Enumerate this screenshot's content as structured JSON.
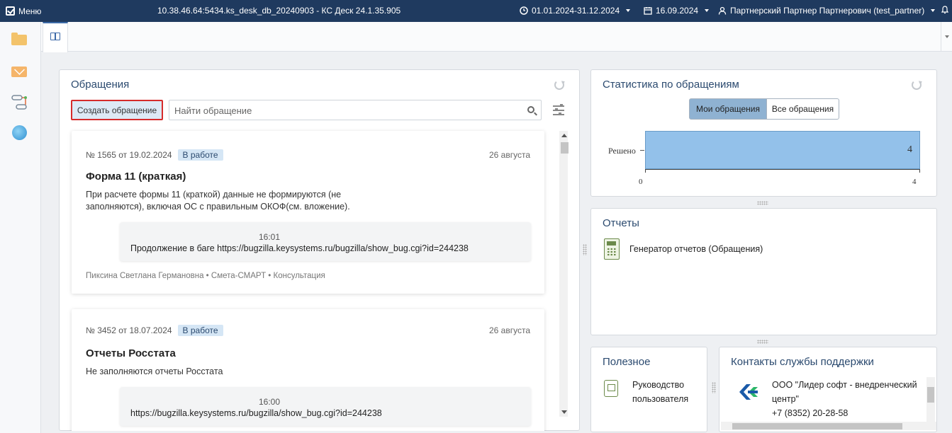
{
  "topbar": {
    "menu_label": "Меню",
    "title": "10.38.46.64:5434.ks_desk_db_20240903 - КС Деск 24.1.35.905",
    "period": "01.01.2024-31.12.2024",
    "date": "16.09.2024",
    "user": "Партнерский Партнер Партнерович (test_partner)"
  },
  "rail": {
    "items": [
      "folder-icon",
      "mail-icon",
      "flow-icon",
      "globe-icon"
    ]
  },
  "appeals": {
    "title": "Обращения",
    "create_label": "Создать обращение",
    "search_placeholder": "Найти обращение",
    "cards": [
      {
        "number": "№ 1565 от 19.02.2024",
        "status": "В работе",
        "date": "26 августа",
        "heading": "Форма 11 (краткая)",
        "desc": "При расчете формы 11 (краткой) данные не формируются (не заполняются), включая ОС с правильным ОКОФ(см. вложение).",
        "time": "16:01",
        "message": "Продолжение в баге https://bugzilla.keysystems.ru/bugzilla/show_bug.cgi?id=244238",
        "footer": "Пиксина Светлана Германовна • Смета-СМАРТ • Консультация"
      },
      {
        "number": "№ 3452 от 18.07.2024",
        "status": "В работе",
        "date": "26 августа",
        "heading": "Отчеты Росстата",
        "desc": "Не заполняются отчеты Росстата",
        "time": "16:00",
        "message": "https://bugzilla.keysystems.ru/bugzilla/show_bug.cgi?id=244238"
      }
    ]
  },
  "stats": {
    "title": "Статистика по обращениям",
    "toggle_mine": "Мои обращения",
    "toggle_all": "Все обращения",
    "colors": {
      "bar": "#93c1ea",
      "active_toggle": "#8fb2d2"
    }
  },
  "chart_data": {
    "type": "bar",
    "orientation": "horizontal",
    "categories": [
      "Решено"
    ],
    "values": [
      4
    ],
    "xlim": [
      0,
      4
    ],
    "xticks": [
      "0",
      "4"
    ],
    "title": "",
    "xlabel": "",
    "ylabel": ""
  },
  "reports": {
    "title": "Отчеты",
    "item": "Генератор отчетов (Обращения)"
  },
  "useful": {
    "title": "Полезное",
    "item_line1": "Руководство",
    "item_line2": "пользователя"
  },
  "contacts": {
    "title": "Контакты службы поддержки",
    "org": "ООО \"Лидер софт - внедренческий центр\"",
    "phone": "+7 (8352) 20-28-58"
  }
}
